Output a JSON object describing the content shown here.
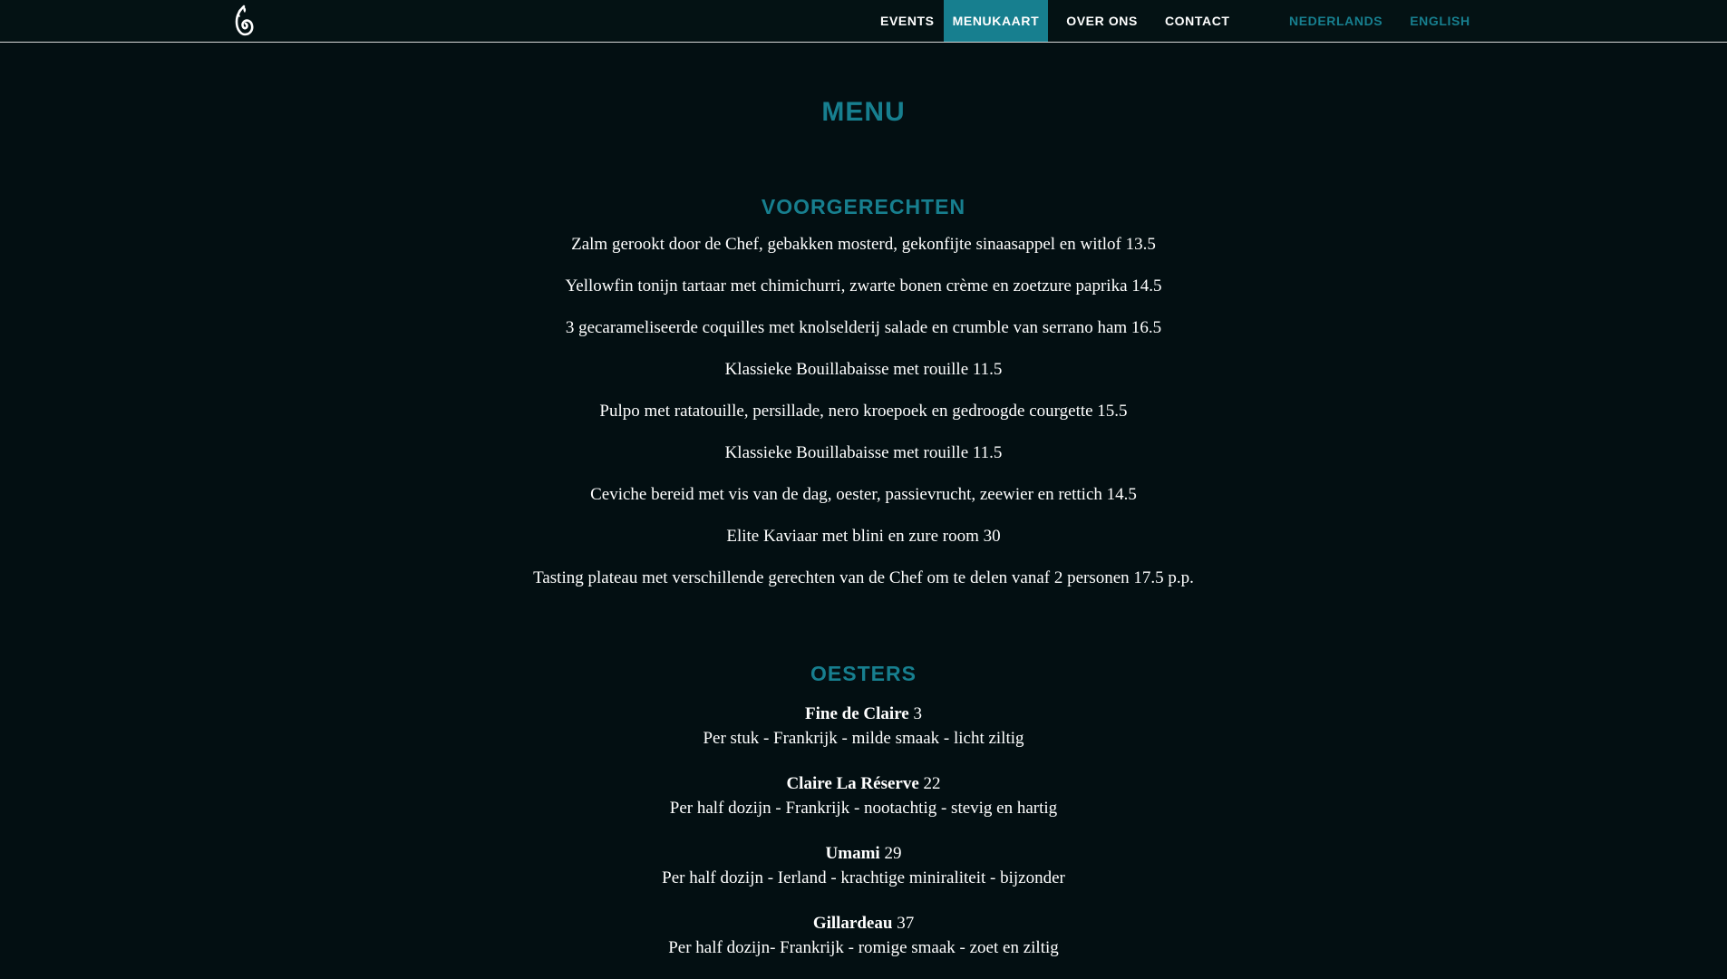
{
  "nav": {
    "logo_icon": "flame-swirl-logo-icon",
    "items": [
      {
        "label": "EVENTS",
        "active": false
      },
      {
        "label": "MENUKAART",
        "active": true
      },
      {
        "label": "OVER ONS",
        "active": false
      },
      {
        "label": "CONTACT",
        "active": false
      }
    ],
    "languages": [
      "NEDERLANDS",
      "ENGLISH"
    ]
  },
  "colors": {
    "background": "#030f12",
    "accent": "#177f8f",
    "text": "#ffffff"
  },
  "page": {
    "title": "MENU"
  },
  "voorgerechten": {
    "title": "VOORGERECHTEN",
    "items": [
      "Zalm gerookt door de Chef, gebakken mosterd, gekonfijte sinaasappel en witlof 13.5",
      "Yellowfin tonijn tartaar met chimichurri, zwarte bonen crème en zoetzure paprika 14.5",
      "3 gecarameliseerde coquilles met knolselderij salade en crumble van serrano ham 16.5",
      "Klassieke Bouillabaisse met rouille 11.5",
      "Pulpo met ratatouille, persillade, nero kroepoek en gedroogde courgette 15.5",
      "Klassieke Bouillabaisse met rouille 11.5",
      "Ceviche bereid met vis van de dag, oester, passievrucht, zeewier en rettich 14.5",
      "Elite Kaviaar met blini en zure room 30",
      "Tasting plateau met verschillende gerechten van de Chef om te delen vanaf 2 personen 17.5 p.p."
    ]
  },
  "oesters": {
    "title": "OESTERS",
    "items": [
      {
        "name": "Fine de Claire",
        "price": "3",
        "description": "Per stuk - Frankrijk - milde smaak - licht ziltig"
      },
      {
        "name": "Claire La Réserve",
        "price": "22",
        "description": "Per half dozijn - Frankrijk - nootachtig - stevig en hartig"
      },
      {
        "name": "Umami",
        "price": "29",
        "description": "Per half dozijn - Ierland - krachtige miniraliteit - bijzonder"
      },
      {
        "name": "Gillardeau",
        "price": "37",
        "description": "Per half dozijn- Frankrijk - romige smaak - zoet en ziltig"
      }
    ]
  }
}
